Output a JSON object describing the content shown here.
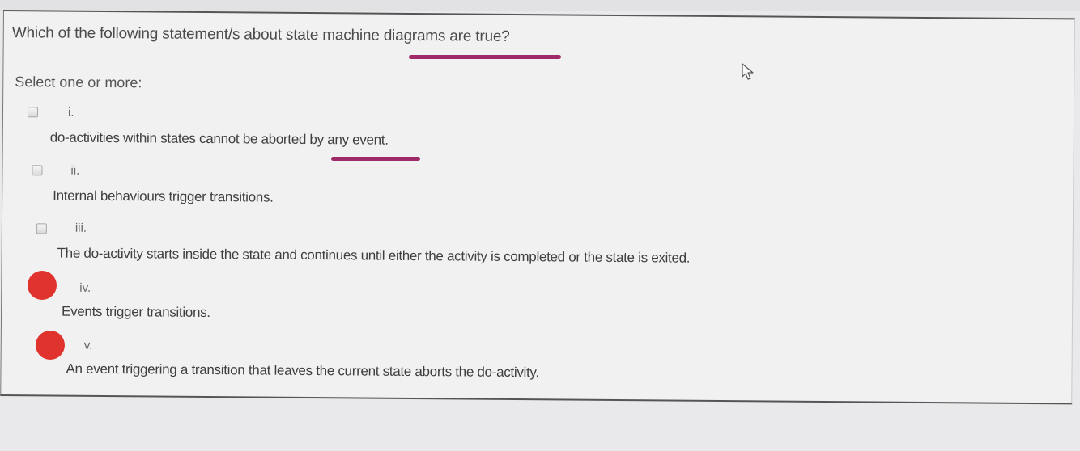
{
  "question": {
    "prompt": "Which of the following statement/s about state machine diagrams are true?",
    "instruction": "Select one or more:"
  },
  "options": [
    {
      "number": "i.",
      "text": "do-activities within states cannot be aborted by any event.",
      "checked": false
    },
    {
      "number": "ii.",
      "text": "Internal behaviours trigger transitions.",
      "checked": false
    },
    {
      "number": "iii.",
      "text": "The do-activity starts inside the state and continues until either the activity is completed or the state is exited.",
      "checked": false
    },
    {
      "number": "iv.",
      "text": "Events trigger transitions.",
      "checked": false
    },
    {
      "number": "v.",
      "text": "An event triggering a transition that leaves the current state aborts the do-activity.",
      "checked": false
    }
  ],
  "annotations": {
    "underline_color": "#a02a68",
    "dot_color": "#e0332e",
    "underlined_phrases": [
      "machine diagrams",
      "aborted by"
    ],
    "dot_marked_options": [
      "iv.",
      "v."
    ]
  },
  "colors": {
    "page_background": "#e9e9eb",
    "panel_background": "#f1f1f2"
  }
}
